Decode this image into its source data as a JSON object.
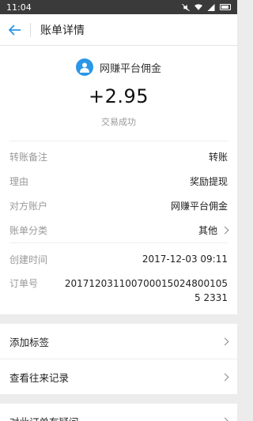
{
  "statusbar": {
    "time": "11:04"
  },
  "nav": {
    "title": "账单详情"
  },
  "header": {
    "payer": "网赚平台佣金",
    "amount": "+2.95",
    "status": "交易成功"
  },
  "details": [
    {
      "label": "转账备注",
      "value": "转账"
    },
    {
      "label": "理由",
      "value": "奖励提现"
    },
    {
      "label": "对方账户",
      "value": "网赚平台佣金"
    },
    {
      "label": "账单分类",
      "value": "其他"
    }
  ],
  "meta": {
    "time_label": "创建时间",
    "time_value": "2017-12-03 09:11",
    "order_label": "订单号",
    "order_value": "2017120311007000150248001055 2331"
  },
  "menu": {
    "add_tag": "添加标签",
    "history": "查看往来记录",
    "question": "对此订单有疑问"
  },
  "colors": {
    "accent": "#2a96e8",
    "statusbar": "#3a3a3a"
  }
}
